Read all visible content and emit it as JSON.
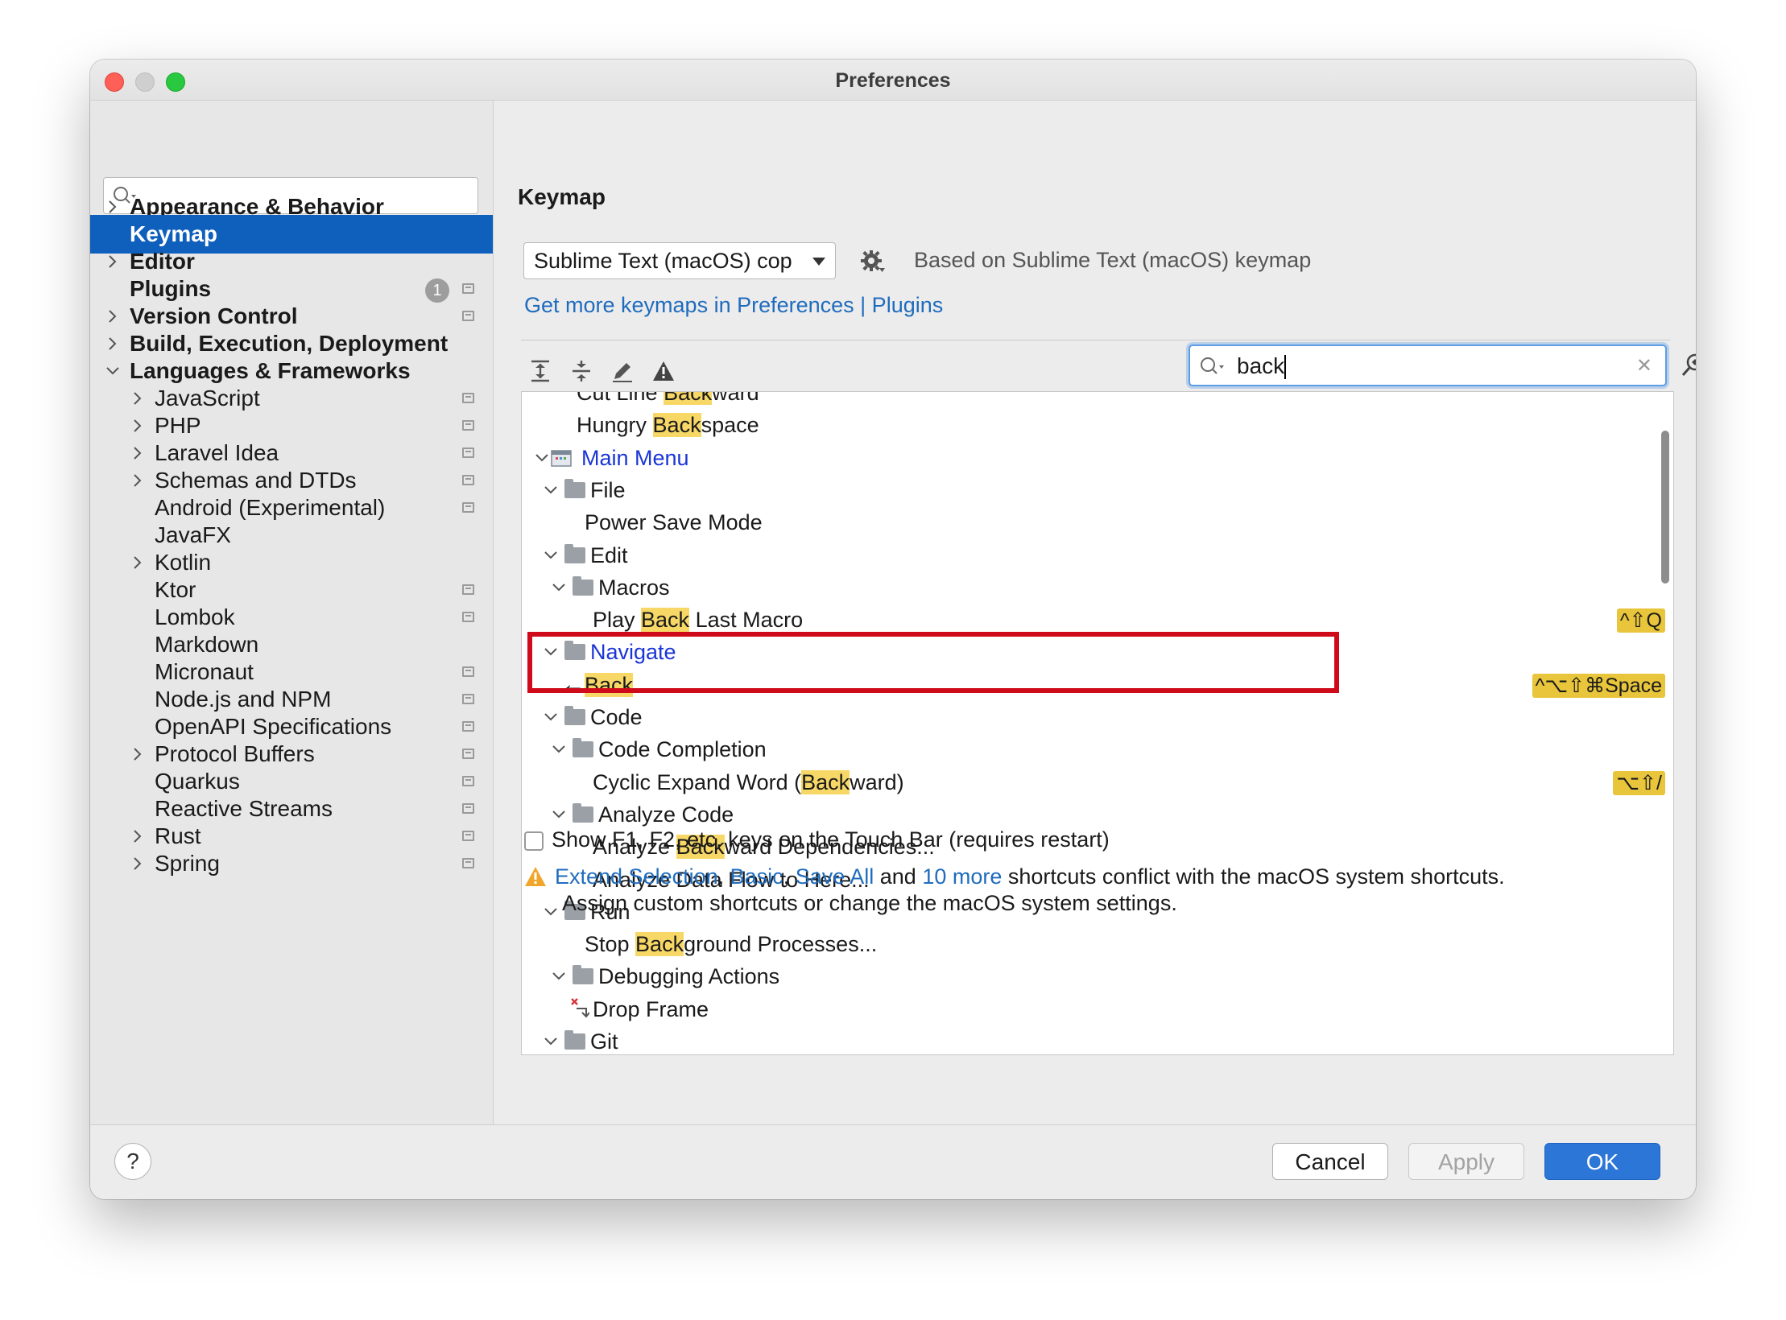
{
  "window": {
    "title": "Preferences"
  },
  "sidebar": {
    "search_placeholder": "",
    "items": [
      {
        "label": "Appearance & Behavior",
        "level": 0,
        "expandable": true,
        "expanded": false,
        "bold": true,
        "selected": false,
        "project_icon": false,
        "badge": null
      },
      {
        "label": "Keymap",
        "level": 0,
        "expandable": false,
        "bold": true,
        "selected": true,
        "project_icon": false,
        "badge": null
      },
      {
        "label": "Editor",
        "level": 0,
        "expandable": true,
        "expanded": false,
        "bold": true,
        "selected": false,
        "project_icon": false,
        "badge": null
      },
      {
        "label": "Plugins",
        "level": 0,
        "expandable": false,
        "bold": true,
        "selected": false,
        "project_icon": true,
        "badge": "1"
      },
      {
        "label": "Version Control",
        "level": 0,
        "expandable": true,
        "expanded": false,
        "bold": true,
        "selected": false,
        "project_icon": true,
        "badge": null
      },
      {
        "label": "Build, Execution, Deployment",
        "level": 0,
        "expandable": true,
        "expanded": false,
        "bold": true,
        "selected": false,
        "project_icon": false,
        "badge": null
      },
      {
        "label": "Languages & Frameworks",
        "level": 0,
        "expandable": true,
        "expanded": true,
        "bold": true,
        "selected": false,
        "project_icon": false,
        "badge": null
      },
      {
        "label": "JavaScript",
        "level": 1,
        "expandable": true,
        "expanded": false,
        "bold": false,
        "selected": false,
        "project_icon": true,
        "badge": null
      },
      {
        "label": "PHP",
        "level": 1,
        "expandable": true,
        "expanded": false,
        "bold": false,
        "selected": false,
        "project_icon": true,
        "badge": null
      },
      {
        "label": "Laravel Idea",
        "level": 1,
        "expandable": true,
        "expanded": false,
        "bold": false,
        "selected": false,
        "project_icon": true,
        "badge": null
      },
      {
        "label": "Schemas and DTDs",
        "level": 1,
        "expandable": true,
        "expanded": false,
        "bold": false,
        "selected": false,
        "project_icon": true,
        "badge": null
      },
      {
        "label": "Android (Experimental)",
        "level": 1,
        "expandable": false,
        "bold": false,
        "selected": false,
        "project_icon": true,
        "badge": null
      },
      {
        "label": "JavaFX",
        "level": 1,
        "expandable": false,
        "bold": false,
        "selected": false,
        "project_icon": false,
        "badge": null
      },
      {
        "label": "Kotlin",
        "level": 1,
        "expandable": true,
        "expanded": false,
        "bold": false,
        "selected": false,
        "project_icon": false,
        "badge": null
      },
      {
        "label": "Ktor",
        "level": 1,
        "expandable": false,
        "bold": false,
        "selected": false,
        "project_icon": true,
        "badge": null
      },
      {
        "label": "Lombok",
        "level": 1,
        "expandable": false,
        "bold": false,
        "selected": false,
        "project_icon": true,
        "badge": null
      },
      {
        "label": "Markdown",
        "level": 1,
        "expandable": false,
        "bold": false,
        "selected": false,
        "project_icon": false,
        "badge": null
      },
      {
        "label": "Micronaut",
        "level": 1,
        "expandable": false,
        "bold": false,
        "selected": false,
        "project_icon": true,
        "badge": null
      },
      {
        "label": "Node.js and NPM",
        "level": 1,
        "expandable": false,
        "bold": false,
        "selected": false,
        "project_icon": true,
        "badge": null
      },
      {
        "label": "OpenAPI Specifications",
        "level": 1,
        "expandable": false,
        "bold": false,
        "selected": false,
        "project_icon": true,
        "badge": null
      },
      {
        "label": "Protocol Buffers",
        "level": 1,
        "expandable": true,
        "expanded": false,
        "bold": false,
        "selected": false,
        "project_icon": true,
        "badge": null
      },
      {
        "label": "Quarkus",
        "level": 1,
        "expandable": false,
        "bold": false,
        "selected": false,
        "project_icon": true,
        "badge": null
      },
      {
        "label": "Reactive Streams",
        "level": 1,
        "expandable": false,
        "bold": false,
        "selected": false,
        "project_icon": true,
        "badge": null
      },
      {
        "label": "Rust",
        "level": 1,
        "expandable": true,
        "expanded": false,
        "bold": false,
        "selected": false,
        "project_icon": true,
        "badge": null
      },
      {
        "label": "Spring",
        "level": 1,
        "expandable": true,
        "expanded": false,
        "bold": false,
        "selected": false,
        "project_icon": true,
        "badge": null
      }
    ]
  },
  "main": {
    "title": "Keymap",
    "back_icon": "arrow-left-icon",
    "forward_icon": "arrow-right-icon",
    "keymap_select": {
      "value": "Sublime Text (macOS) cop"
    },
    "based_on": "Based on Sublime Text (macOS) keymap",
    "more_keymaps_link": "Get more keymaps in Preferences | Plugins",
    "toolbar_icons": [
      "expand-all-icon",
      "collapse-all-icon",
      "edit-shortcut-icon",
      "conflicts-warning-icon"
    ],
    "filter": {
      "value": "back",
      "placeholder": ""
    },
    "find_by_shortcut_icon": "find-by-shortcut-icon",
    "tree": [
      {
        "level": 2,
        "kind": "action",
        "parts": [
          [
            "Cut Line ",
            false
          ],
          [
            "Back",
            true
          ],
          [
            "ward",
            false
          ]
        ],
        "shortcut": null,
        "expandable": false,
        "blue": false
      },
      {
        "level": 2,
        "kind": "action",
        "parts": [
          [
            "Hungry ",
            false
          ],
          [
            "Back",
            true
          ],
          [
            "space",
            false
          ]
        ],
        "shortcut": null,
        "expandable": false,
        "blue": false
      },
      {
        "level": 0,
        "kind": "menu",
        "parts": [
          [
            "Main Menu",
            false
          ]
        ],
        "shortcut": null,
        "expandable": true,
        "blue": true
      },
      {
        "level": 1,
        "kind": "folder",
        "parts": [
          [
            "File",
            false
          ]
        ],
        "shortcut": null,
        "expandable": true,
        "blue": false
      },
      {
        "level": 2,
        "kind": "action",
        "parts": [
          [
            "Power Save Mode",
            false
          ]
        ],
        "shortcut": null,
        "expandable": false,
        "blue": false
      },
      {
        "level": 1,
        "kind": "folder",
        "parts": [
          [
            "Edit",
            false
          ]
        ],
        "shortcut": null,
        "expandable": true,
        "blue": false
      },
      {
        "level": 2,
        "kind": "folder",
        "parts": [
          [
            "Macros",
            false
          ]
        ],
        "shortcut": null,
        "expandable": true,
        "blue": false
      },
      {
        "level": 3,
        "kind": "action",
        "parts": [
          [
            "Play ",
            false
          ],
          [
            "Back",
            true
          ],
          [
            " Last Macro",
            false
          ]
        ],
        "shortcut": "^⇧Q",
        "expandable": false,
        "blue": false
      },
      {
        "level": 1,
        "kind": "folder",
        "parts": [
          [
            "Navigate",
            false
          ]
        ],
        "shortcut": null,
        "expandable": true,
        "blue": true
      },
      {
        "level": 2,
        "kind": "back-action",
        "parts": [
          [
            "Back",
            true
          ]
        ],
        "shortcut": "^⌥⇧⌘Space",
        "expandable": false,
        "blue": false
      },
      {
        "level": 1,
        "kind": "folder",
        "parts": [
          [
            "Code",
            false
          ]
        ],
        "shortcut": null,
        "expandable": true,
        "blue": false
      },
      {
        "level": 2,
        "kind": "folder",
        "parts": [
          [
            "Code Completion",
            false
          ]
        ],
        "shortcut": null,
        "expandable": true,
        "blue": false
      },
      {
        "level": 3,
        "kind": "action",
        "parts": [
          [
            "Cyclic Expand Word (",
            false
          ],
          [
            "Back",
            true
          ],
          [
            "ward)",
            false
          ]
        ],
        "shortcut": "⌥⇧/",
        "expandable": false,
        "blue": false
      },
      {
        "level": 2,
        "kind": "folder",
        "parts": [
          [
            "Analyze Code",
            false
          ]
        ],
        "shortcut": null,
        "expandable": true,
        "blue": false
      },
      {
        "level": 3,
        "kind": "action",
        "parts": [
          [
            "Analyze ",
            false
          ],
          [
            "Back",
            true
          ],
          [
            "ward Dependencies...",
            false
          ]
        ],
        "shortcut": null,
        "expandable": false,
        "blue": false
      },
      {
        "level": 3,
        "kind": "action",
        "parts": [
          [
            "Analyze Data Flow to Here...",
            false
          ]
        ],
        "shortcut": null,
        "expandable": false,
        "blue": false
      },
      {
        "level": 1,
        "kind": "folder",
        "parts": [
          [
            "Run",
            false
          ]
        ],
        "shortcut": null,
        "expandable": true,
        "blue": false
      },
      {
        "level": 2,
        "kind": "action",
        "parts": [
          [
            "Stop ",
            false
          ],
          [
            "Back",
            true
          ],
          [
            "ground Processes...",
            false
          ]
        ],
        "shortcut": null,
        "expandable": false,
        "blue": false
      },
      {
        "level": 2,
        "kind": "folder",
        "parts": [
          [
            "Debugging Actions",
            false
          ]
        ],
        "shortcut": null,
        "expandable": true,
        "blue": false
      },
      {
        "level": 3,
        "kind": "drop-frame",
        "parts": [
          [
            "Drop Frame",
            false
          ]
        ],
        "shortcut": null,
        "expandable": false,
        "blue": false
      },
      {
        "level": 1,
        "kind": "folder",
        "parts": [
          [
            "Git",
            false
          ]
        ],
        "shortcut": null,
        "expandable": true,
        "blue": false
      }
    ],
    "touchbar_label": "Show F1, F2, etc. keys on the Touch Bar (requires restart)",
    "touchbar_checked": false,
    "warning": {
      "links": [
        "Extend Selection",
        "Basic",
        "Save All",
        "10 more"
      ],
      "sep1": ", ",
      "sep2": ", ",
      "and": " and ",
      "tail": " shortcuts conflict with the macOS system shortcuts.",
      "line2": "Assign custom shortcuts or change the macOS system settings."
    }
  },
  "footer": {
    "help": "?",
    "cancel": "Cancel",
    "apply": "Apply",
    "ok": "OK"
  }
}
